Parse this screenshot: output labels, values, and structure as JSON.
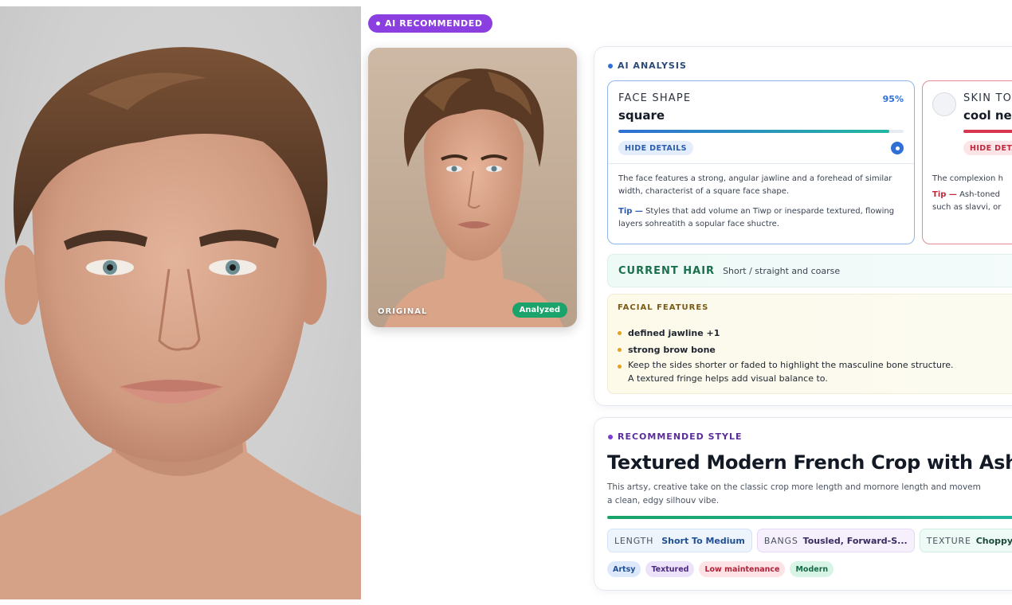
{
  "badge": {
    "label": "AI RECOMMENDED"
  },
  "photo": {
    "label": "ORIGINAL",
    "status": "Analyzed"
  },
  "analysis": {
    "heading": "AI ANALYSIS",
    "face_shape": {
      "label": "FACE SHAPE",
      "value": "square",
      "confidence": "95%",
      "confidence_fraction": 0.95,
      "toggle_label": "HIDE DETAILS",
      "description": "The face features a strong, angular jawline and a forehead of similar width, characterist of a square face shape.",
      "tip_prefix": "Tip —",
      "tip_text": " Styles that add volume an Tiwp or inesparde textured, flowing layers sohreatith a sopular face shuctre."
    },
    "skin_tone": {
      "label": "SKIN TO",
      "value": "cool neu",
      "toggle_label": "HIDE DETA",
      "description": "The complexion h",
      "tip_prefix": "Tip —",
      "tip_text": " Ash-toned",
      "tip_text_2": "such as slavvi, or",
      "accent": "#d8364f"
    },
    "current_hair": {
      "label": "CURRENT HAIR",
      "value": "Short / straight and coarse"
    },
    "facial_features": {
      "label": "FACIAL FEATURES",
      "items": [
        "defined jawline +1",
        "strong brow bone"
      ],
      "note_line_1": "Keep the sides shorter or faded to highlight the masculine bone structure.",
      "note_line_2": "A textured fringe helps add visual balance to."
    }
  },
  "recommended": {
    "heading": "RECOMMENDED STYLE",
    "title": "Textured Modern French Crop with Ash-Ton",
    "description_line_1": "This artsy, creative take on the classic crop more length and mornore length and movem",
    "description_line_2": "a clean, edgy silhouv vibe.",
    "attributes": [
      {
        "key": "LENGTH",
        "value": "Short To Medium"
      },
      {
        "key": "BANGS",
        "value": "Tousled, Forward-S..."
      },
      {
        "key": "TEXTURE",
        "value": "Choppy"
      }
    ],
    "tags": [
      "Artsy",
      "Textured",
      "Low maintenance",
      "Modern"
    ]
  },
  "colors": {
    "accent_purple": "#8b3fe0",
    "accent_blue": "#2f6fd6",
    "accent_green": "#1aa36a",
    "accent_red": "#d8364f"
  }
}
